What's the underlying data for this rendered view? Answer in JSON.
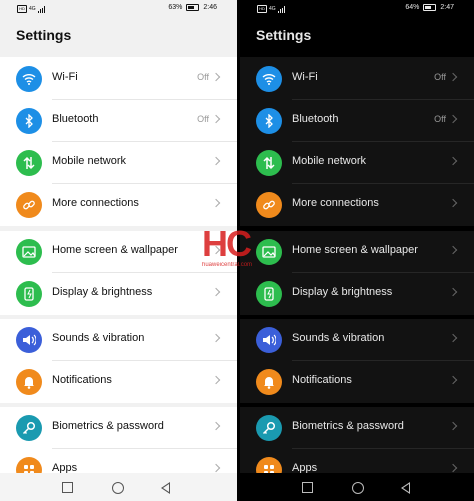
{
  "light": {
    "status": {
      "network": "HD",
      "net_type": "4G",
      "battery": "63%",
      "time": "2:46"
    },
    "title": "Settings"
  },
  "dark": {
    "status": {
      "network": "HD",
      "net_type": "4G",
      "battery": "64%",
      "time": "2:47"
    },
    "title": "Settings"
  },
  "rows": [
    {
      "label": "Wi-Fi",
      "value": "Off",
      "icon": "wifi-icon",
      "color": "#1d8fe6"
    },
    {
      "label": "Bluetooth",
      "value": "Off",
      "icon": "bluetooth-icon",
      "color": "#1d8fe6"
    },
    {
      "label": "Mobile network",
      "value": "",
      "icon": "mobile-data-icon",
      "color": "#2dbd4e"
    },
    {
      "label": "More connections",
      "value": "",
      "icon": "link-icon",
      "color": "#f08a1c"
    },
    {
      "label": "Home screen & wallpaper",
      "value": "",
      "icon": "image-icon",
      "color": "#2dbd4e"
    },
    {
      "label": "Display & brightness",
      "value": "",
      "icon": "phone-display-icon",
      "color": "#2dbd4e"
    },
    {
      "label": "Sounds & vibration",
      "value": "",
      "icon": "speaker-icon",
      "color": "#3b5fd9"
    },
    {
      "label": "Notifications",
      "value": "",
      "icon": "bell-icon",
      "color": "#f08a1c"
    },
    {
      "label": "Biometrics & password",
      "value": "",
      "icon": "key-icon",
      "color": "#1a9ab0"
    },
    {
      "label": "Apps",
      "value": "",
      "icon": "apps-grid-icon",
      "color": "#f08a1c"
    }
  ],
  "watermark": {
    "logo": "HC",
    "url": "huaweicentral.com"
  }
}
